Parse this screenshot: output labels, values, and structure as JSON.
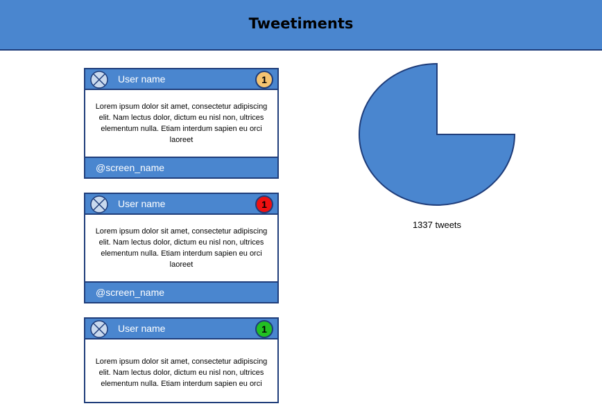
{
  "header": {
    "title": "Tweetiments"
  },
  "colors": {
    "accent": "#4a86cf",
    "border": "#1f3d7a",
    "badge_yellow": "#f5c471",
    "badge_red": "#ee1111",
    "badge_green": "#22c022"
  },
  "tweets": [
    {
      "user_name": "User name",
      "badge": "1",
      "badge_color": "#f5c471",
      "text": "Lorem ipsum dolor sit amet, consectetur adipiscing elit. Nam lectus dolor, dictum eu nisl non, ultrices elementum nulla. Etiam interdum sapien eu orci laoreet",
      "screen_name": "@screen_name",
      "avatar_icon": "avatar-placeholder-icon"
    },
    {
      "user_name": "User name",
      "badge": "1",
      "badge_color": "#ee1111",
      "text": "Lorem ipsum dolor sit amet, consectetur adipiscing elit. Nam lectus dolor, dictum eu nisl non, ultrices elementum nulla. Etiam interdum sapien eu orci laoreet",
      "screen_name": "@screen_name",
      "avatar_icon": "avatar-placeholder-icon"
    },
    {
      "user_name": "User name",
      "badge": "1",
      "badge_color": "#22c022",
      "text": "Lorem ipsum dolor sit amet, consectetur adipiscing elit. Nam lectus dolor, dictum eu nisl non, ultrices elementum nulla. Etiam interdum sapien eu orci",
      "screen_name": "",
      "avatar_icon": "avatar-placeholder-icon"
    }
  ],
  "chart": {
    "caption": "1337 tweets",
    "filled_fraction": 0.75,
    "fill_color": "#4a86cf"
  }
}
